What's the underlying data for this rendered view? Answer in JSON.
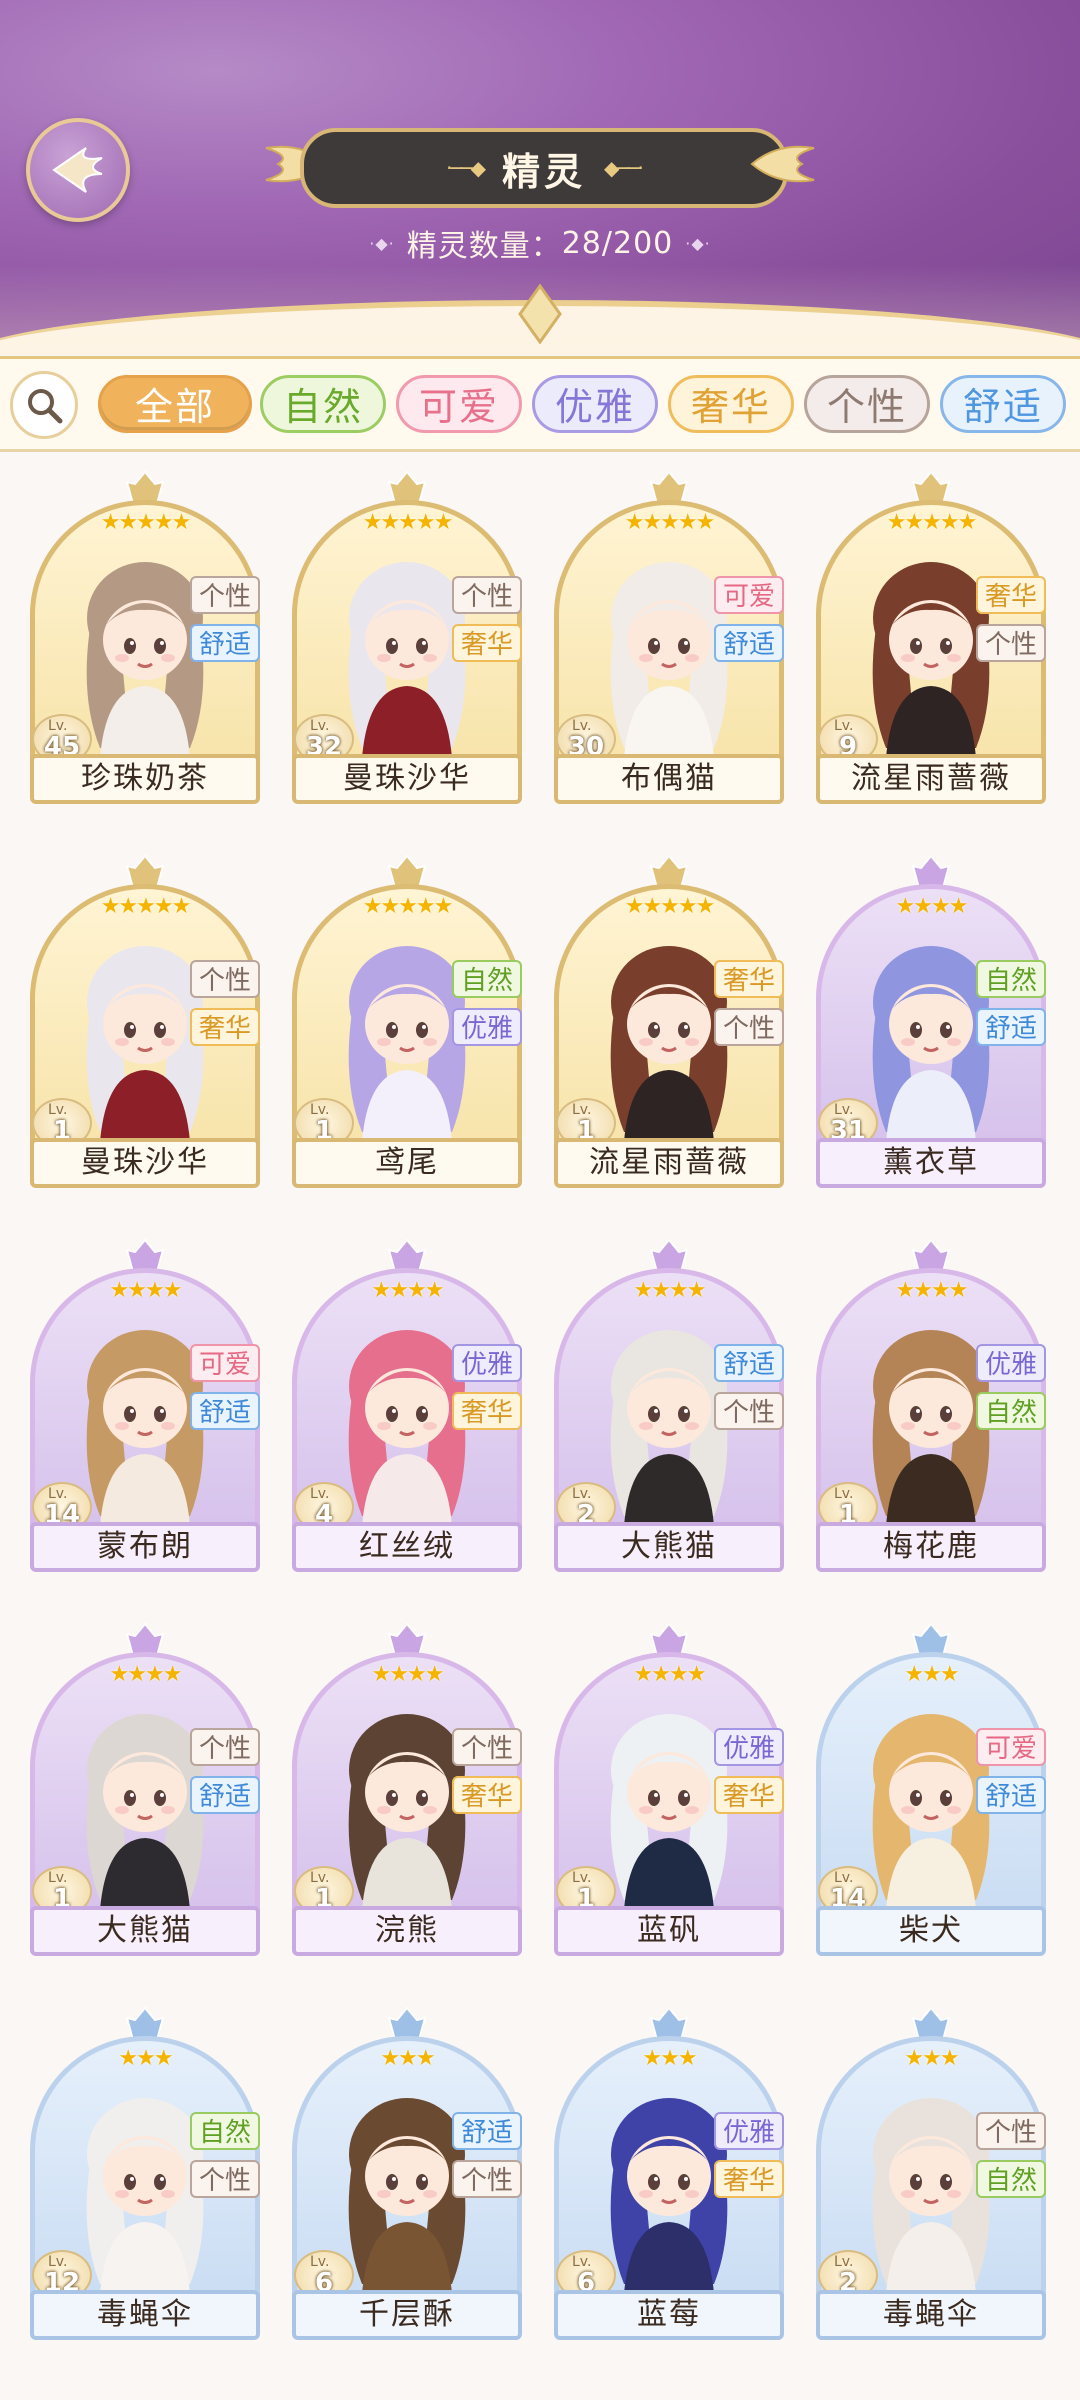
{
  "header": {
    "title": "精灵",
    "count_label": "精灵数量：",
    "count_value": "28/200"
  },
  "filters": [
    {
      "label": "全部",
      "selected": true,
      "bg": "#f0b35c",
      "border": "#e6a24a",
      "color": "#ffffff"
    },
    {
      "label": "自然",
      "selected": false,
      "bg": "#eef7dc",
      "border": "#9ccd63",
      "color": "#6aaa2a"
    },
    {
      "label": "可爱",
      "selected": false,
      "bg": "#fde9ee",
      "border": "#f19aae",
      "color": "#e8708b"
    },
    {
      "label": "优雅",
      "selected": false,
      "bg": "#ecebfb",
      "border": "#a99be3",
      "color": "#8676d8"
    },
    {
      "label": "奢华",
      "selected": false,
      "bg": "#fff3d9",
      "border": "#f0bd5c",
      "color": "#e0a235"
    },
    {
      "label": "个性",
      "selected": false,
      "bg": "#f4ecea",
      "border": "#b7a49b",
      "color": "#8e7a70"
    },
    {
      "label": "舒适",
      "selected": false,
      "bg": "#e7f2fd",
      "border": "#87b7ea",
      "color": "#4f97e0"
    }
  ],
  "tag_styles": {
    "个性": {
      "bg": "#fbf3ee",
      "border": "#b9a59b",
      "color": "#7f6a60"
    },
    "舒适": {
      "bg": "#eaf4fe",
      "border": "#80b3e8",
      "color": "#3f8ad8"
    },
    "奢华": {
      "bg": "#fff4dc",
      "border": "#f0bc57",
      "color": "#d99a25"
    },
    "可爱": {
      "bg": "#fdecf0",
      "border": "#ef94a9",
      "color": "#e66883"
    },
    "自然": {
      "bg": "#f0f8e1",
      "border": "#99cb60",
      "color": "#5f9f22"
    },
    "优雅": {
      "bg": "#efedfb",
      "border": "#a496e2",
      "color": "#7968d4"
    }
  },
  "spirits": [
    {
      "name": "珍珠奶茶",
      "level": "45",
      "stars": "★★★★★",
      "tags": [
        "个性",
        "舒适"
      ],
      "frame": "gold",
      "hair": "#b49a84",
      "outfit": "#f3eee9"
    },
    {
      "name": "曼珠沙华",
      "level": "32",
      "stars": "★★★★★",
      "tags": [
        "个性",
        "奢华"
      ],
      "frame": "gold",
      "hair": "#e9e6ee",
      "outfit": "#8c1f28"
    },
    {
      "name": "布偶猫",
      "level": "30",
      "stars": "★★★★★",
      "tags": [
        "可爱",
        "舒适"
      ],
      "frame": "gold",
      "hair": "#f1ece7",
      "outfit": "#f9f5f1"
    },
    {
      "name": "流星雨蔷薇",
      "level": "9",
      "stars": "★★★★★",
      "tags": [
        "奢华",
        "个性"
      ],
      "frame": "gold",
      "hair": "#7a3f2c",
      "outfit": "#2e2424"
    },
    {
      "name": "曼珠沙华",
      "level": "1",
      "stars": "★★★★★",
      "tags": [
        "个性",
        "奢华"
      ],
      "frame": "gold",
      "hair": "#e9e6ee",
      "outfit": "#8c1f28"
    },
    {
      "name": "鸢尾",
      "level": "1",
      "stars": "★★★★★",
      "tags": [
        "自然",
        "优雅"
      ],
      "frame": "gold",
      "hair": "#b7a6e6",
      "outfit": "#f3f0fb"
    },
    {
      "name": "流星雨蔷薇",
      "level": "1",
      "stars": "★★★★★",
      "tags": [
        "奢华",
        "个性"
      ],
      "frame": "gold",
      "hair": "#7a3f2c",
      "outfit": "#2e2424"
    },
    {
      "name": "薰衣草",
      "level": "31",
      "stars": "★★★★",
      "tags": [
        "自然",
        "舒适"
      ],
      "frame": "purple",
      "hair": "#8f95df",
      "outfit": "#eceefa"
    },
    {
      "name": "蒙布朗",
      "level": "14",
      "stars": "★★★★",
      "tags": [
        "可爱",
        "舒适"
      ],
      "frame": "purple",
      "hair": "#c69a64",
      "outfit": "#f5eadf"
    },
    {
      "name": "红丝绒",
      "level": "4",
      "stars": "★★★★",
      "tags": [
        "优雅",
        "奢华"
      ],
      "frame": "purple",
      "hair": "#e56f8d",
      "outfit": "#f6e9ea"
    },
    {
      "name": "大熊猫",
      "level": "2",
      "stars": "★★★★",
      "tags": [
        "舒适",
        "个性"
      ],
      "frame": "purple",
      "hair": "#e9e5e1",
      "outfit": "#2e2a2a"
    },
    {
      "name": "梅花鹿",
      "level": "1",
      "stars": "★★★★",
      "tags": [
        "优雅",
        "自然"
      ],
      "frame": "purple",
      "hair": "#b48456",
      "outfit": "#3b2b21"
    },
    {
      "name": "大熊猫",
      "level": "1",
      "stars": "★★★★",
      "tags": [
        "个性",
        "舒适"
      ],
      "frame": "purple",
      "hair": "#dcd7d2",
      "outfit": "#2d2b2f"
    },
    {
      "name": "浣熊",
      "level": "1",
      "stars": "★★★★",
      "tags": [
        "个性",
        "奢华"
      ],
      "frame": "purple",
      "hair": "#5c4333",
      "outfit": "#e8e4dc"
    },
    {
      "name": "蓝矾",
      "level": "1",
      "stars": "★★★★",
      "tags": [
        "优雅",
        "奢华"
      ],
      "frame": "purple",
      "hair": "#eef1f4",
      "outfit": "#1f2a44"
    },
    {
      "name": "柴犬",
      "level": "14",
      "stars": "★★★",
      "tags": [
        "可爱",
        "舒适"
      ],
      "frame": "blue",
      "hair": "#e4b66e",
      "outfit": "#f7efe0"
    },
    {
      "name": "毒蝇伞",
      "level": "12",
      "stars": "★★★",
      "tags": [
        "自然",
        "个性"
      ],
      "frame": "blue",
      "hair": "#f1eeee",
      "outfit": "#f7f3f0"
    },
    {
      "name": "千层酥",
      "level": "6",
      "stars": "★★★",
      "tags": [
        "舒适",
        "个性"
      ],
      "frame": "blue",
      "hair": "#6a4a31",
      "outfit": "#7a5534"
    },
    {
      "name": "蓝莓",
      "level": "6",
      "stars": "★★★",
      "tags": [
        "优雅",
        "奢华"
      ],
      "frame": "blue",
      "hair": "#3f43a8",
      "outfit": "#2d2f6a"
    },
    {
      "name": "毒蝇伞",
      "level": "2",
      "stars": "★★★",
      "tags": [
        "个性",
        "自然"
      ],
      "frame": "blue",
      "hair": "#e9e2dc",
      "outfit": "#f4efea"
    }
  ]
}
